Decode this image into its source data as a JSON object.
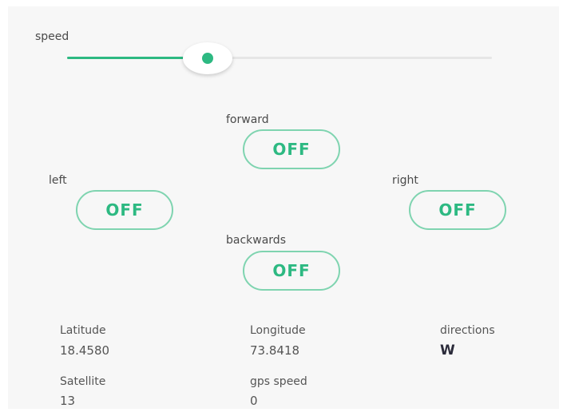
{
  "speed": {
    "label": "speed",
    "value_fraction": 0.33
  },
  "controls": {
    "forward": {
      "label": "forward",
      "state": "OFF"
    },
    "left": {
      "label": "left",
      "state": "OFF"
    },
    "right": {
      "label": "right",
      "state": "OFF"
    },
    "backwards": {
      "label": "backwards",
      "state": "OFF"
    }
  },
  "telemetry": {
    "latitude": {
      "label": "Latitude",
      "value": "18.4580"
    },
    "longitude": {
      "label": "Longitude",
      "value": "73.8418"
    },
    "directions": {
      "label": "directions",
      "value": "W"
    },
    "satellite": {
      "label": "Satellite",
      "value": "13"
    },
    "gps_speed": {
      "label": "gps speed",
      "value": "0"
    }
  },
  "colors": {
    "accent": "#2db982",
    "accent_border": "#7fd4b0",
    "track": "#e6e6e6",
    "background": "#f7f7f7"
  }
}
